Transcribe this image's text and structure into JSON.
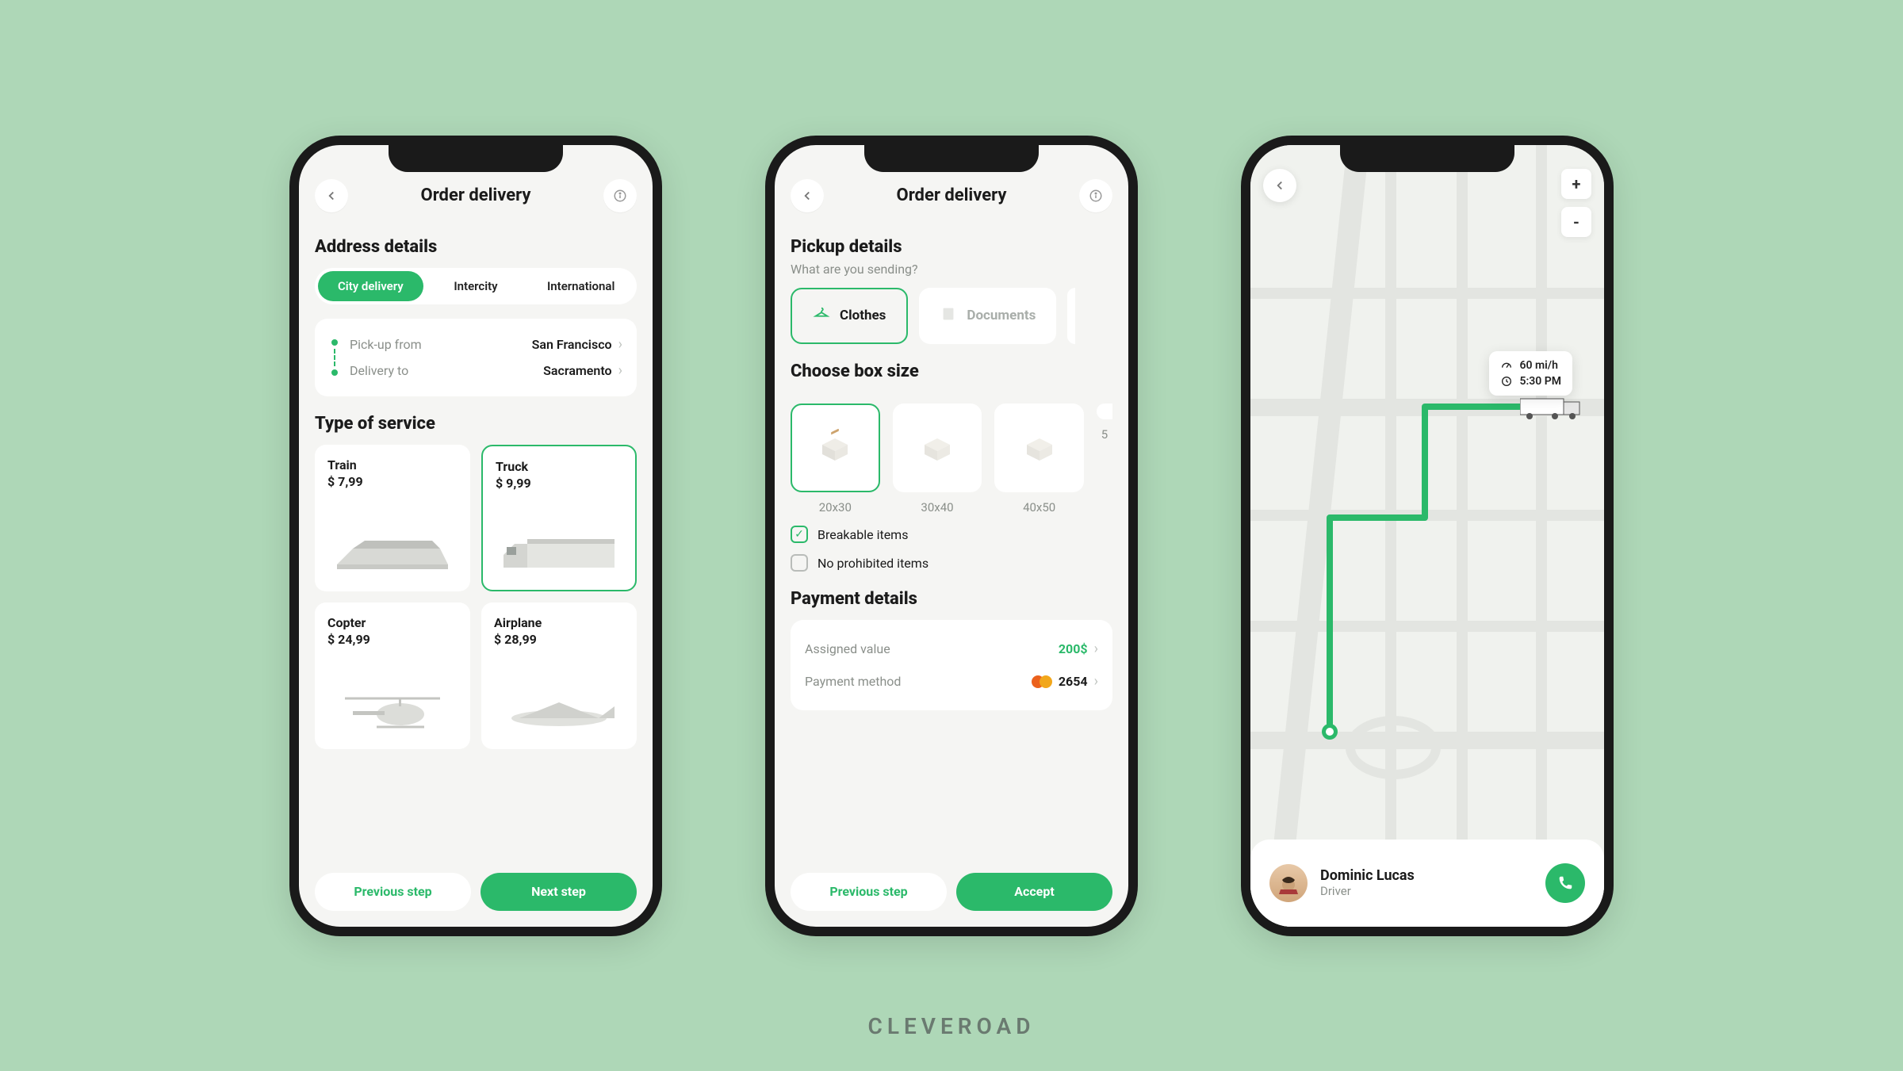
{
  "brand": "CLEVEROAD",
  "screens": {
    "order": {
      "title": "Order delivery",
      "address_header": "Address details",
      "tabs": [
        "City delivery",
        "Intercity",
        "International"
      ],
      "tabs_active": 0,
      "pickup_label": "Pick-up from",
      "pickup_value": "San Francisco",
      "delivery_label": "Delivery to",
      "delivery_value": "Sacramento",
      "service_header": "Type of service",
      "services": [
        {
          "name": "Train",
          "price": "$ 7,99",
          "selected": false
        },
        {
          "name": "Truck",
          "price": "$ 9,99",
          "selected": true
        },
        {
          "name": "Copter",
          "price": "$ 24,99",
          "selected": false
        },
        {
          "name": "Airplane",
          "price": "$ 28,99",
          "selected": false
        }
      ],
      "prev_btn": "Previous step",
      "next_btn": "Next step"
    },
    "pickup": {
      "title": "Order delivery",
      "header": "Pickup details",
      "sub": "What are you sending?",
      "categories": [
        {
          "name": "Clothes",
          "icon": "hanger-icon",
          "selected": true
        },
        {
          "name": "Documents",
          "icon": "document-icon",
          "selected": false
        }
      ],
      "box_header": "Choose box size",
      "boxes": [
        {
          "size": "20x30",
          "selected": true
        },
        {
          "size": "30x40",
          "selected": false
        },
        {
          "size": "40x50",
          "selected": false
        }
      ],
      "box_partial": "5",
      "check_breakable": "Breakable items",
      "check_prohibited": "No prohibited items",
      "breakable_checked": true,
      "prohibited_checked": false,
      "payment_header": "Payment details",
      "assigned_label": "Assigned value",
      "assigned_value": "200$",
      "method_label": "Payment method",
      "method_value": "2654",
      "prev_btn": "Previous step",
      "accept_btn": "Accept"
    },
    "map": {
      "speed": "60 mi/h",
      "time": "5:30 PM",
      "driver_name": "Dominic Lucas",
      "driver_role": "Driver",
      "zoom_in": "+",
      "zoom_out": "-"
    }
  },
  "colors": {
    "accent": "#2bb96a"
  }
}
